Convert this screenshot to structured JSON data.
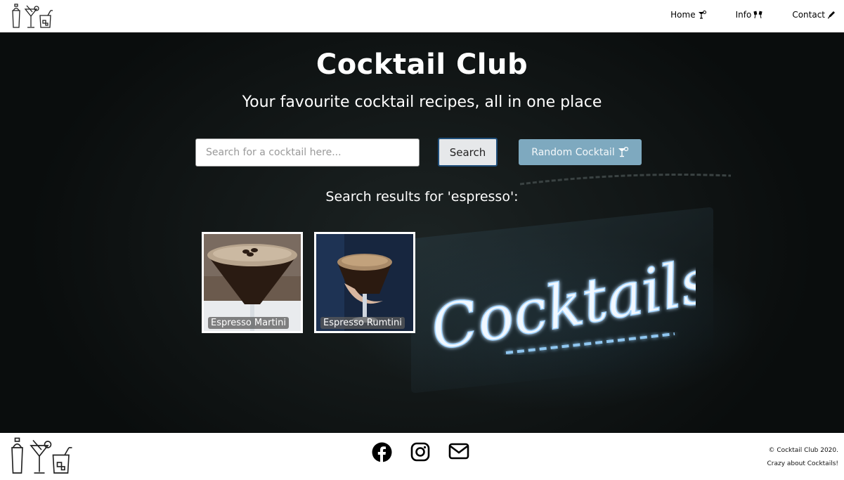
{
  "nav": {
    "logo_icon": "cocktail-set-icon",
    "links": [
      {
        "label": "Home",
        "icon": "cocktail-glass-icon"
      },
      {
        "label": "Info",
        "icon": "cheers-icon"
      },
      {
        "label": "Contact",
        "icon": "pen-icon"
      }
    ]
  },
  "hero": {
    "title": "Cocktail Club",
    "subtitle": "Your favourite cocktail recipes, all in one place",
    "search": {
      "placeholder": "Search for a cocktail here..."
    },
    "search_button": "Search",
    "random_button": {
      "label": "Random Cocktail",
      "icon": "cocktail-glass-icon"
    },
    "results_heading": "Search results for 'espresso':",
    "results": [
      {
        "name": "Espresso Martini"
      },
      {
        "name": "Espresso Rumtini"
      }
    ]
  },
  "footer": {
    "logo_icon": "cocktail-set-icon",
    "social": [
      "facebook-icon",
      "instagram-icon",
      "email-icon"
    ],
    "copyright": "© Cocktail Club 2020.",
    "tagline": "Crazy about Cocktails!"
  },
  "colors": {
    "hero_bg": "#0d1111",
    "random_button_bg": "#7ea9bf",
    "search_button_border": "#1f4e7a",
    "neon": "#e8f4ff"
  }
}
